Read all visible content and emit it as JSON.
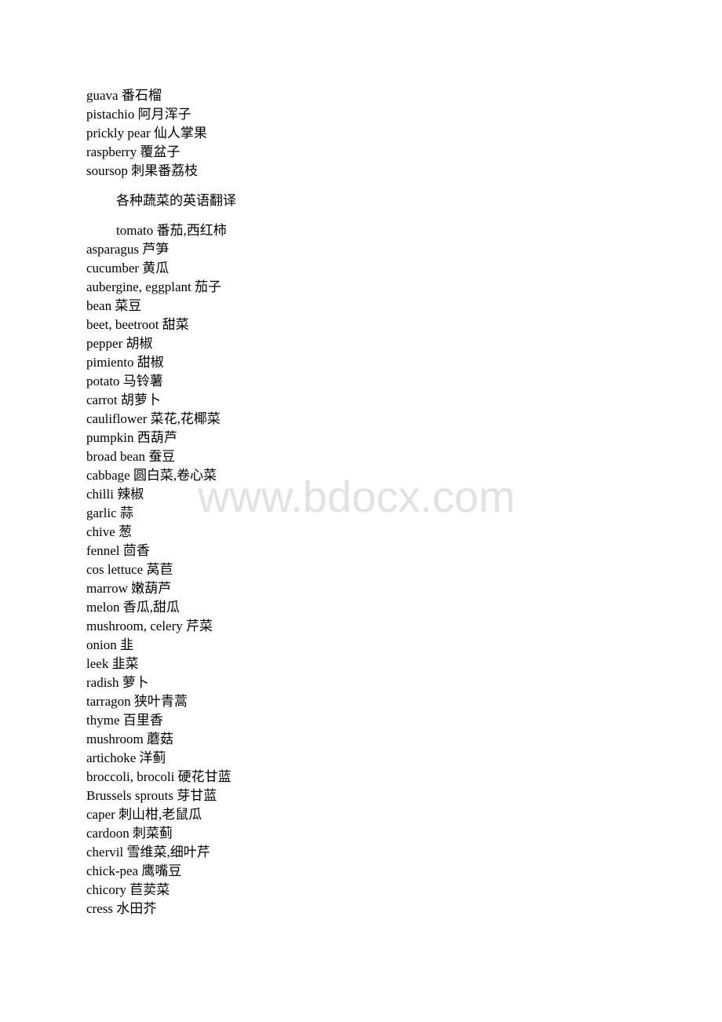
{
  "fruits": [
    {
      "en": "guava",
      "zh": "番石榴"
    },
    {
      "en": "pistachio",
      "zh": "阿月浑子"
    },
    {
      "en": "prickly pear",
      "zh": "仙人掌果"
    },
    {
      "en": "raspberry",
      "zh": "覆盆子"
    },
    {
      "en": "soursop",
      "zh": "刺果番荔枝"
    }
  ],
  "section_heading": "各种蔬菜的英语翻译",
  "vegetables": [
    {
      "en": "tomato",
      "zh": "番茄,西红柿"
    },
    {
      "en": "asparagus",
      "zh": "芦笋"
    },
    {
      "en": "cucumber",
      "zh": "黄瓜"
    },
    {
      "en": "aubergine, eggplant",
      "zh": "茄子"
    },
    {
      "en": "bean",
      "zh": "菜豆"
    },
    {
      "en": "beet, beetroot",
      "zh": "甜菜"
    },
    {
      "en": "pepper",
      "zh": "胡椒"
    },
    {
      "en": "pimiento",
      "zh": "甜椒"
    },
    {
      "en": "potato",
      "zh": "马铃薯"
    },
    {
      "en": "carrot",
      "zh": "胡萝卜"
    },
    {
      "en": "cauliflower",
      "zh": "菜花,花椰菜"
    },
    {
      "en": "pumpkin",
      "zh": "西葫芦"
    },
    {
      "en": "broad bean",
      "zh": "蚕豆"
    },
    {
      "en": "cabbage",
      "zh": "圆白菜,卷心菜"
    },
    {
      "en": "chilli",
      "zh": "辣椒"
    },
    {
      "en": "garlic",
      "zh": "蒜"
    },
    {
      "en": "chive",
      "zh": "葱"
    },
    {
      "en": "fennel",
      "zh": "茴香"
    },
    {
      "en": "cos lettuce",
      "zh": "莴苣"
    },
    {
      "en": "marrow",
      "zh": "嫩葫芦"
    },
    {
      "en": "melon",
      "zh": "香瓜,甜瓜"
    },
    {
      "en": "mushroom, celery",
      "zh": "芹菜"
    },
    {
      "en": "onion",
      "zh": "韭"
    },
    {
      "en": "leek",
      "zh": "韭菜"
    },
    {
      "en": "radish",
      "zh": "萝卜"
    },
    {
      "en": "tarragon",
      "zh": "狭叶青蒿"
    },
    {
      "en": "thyme",
      "zh": "百里香"
    },
    {
      "en": "mushroom",
      "zh": "蘑菇"
    },
    {
      "en": "artichoke",
      "zh": "洋蓟"
    },
    {
      "en": "broccoli, brocoli",
      "zh": "硬花甘蓝"
    },
    {
      "en": "Brussels sprouts",
      "zh": "芽甘蓝"
    },
    {
      "en": "caper",
      "zh": "刺山柑,老鼠瓜"
    },
    {
      "en": "cardoon",
      "zh": "刺菜蓟"
    },
    {
      "en": "chervil",
      "zh": "雪维菜,细叶芹"
    },
    {
      "en": "chick-pea",
      "zh": "鹰嘴豆"
    },
    {
      "en": "chicory",
      "zh": "苣荬菜"
    },
    {
      "en": "cress",
      "zh": "水田芥"
    }
  ],
  "watermark": "www.bdocx.com"
}
